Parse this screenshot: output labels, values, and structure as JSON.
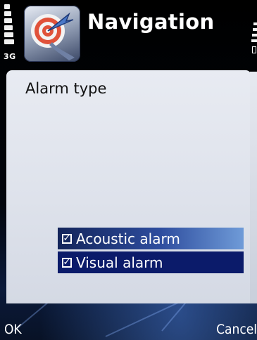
{
  "status": {
    "network_label": "3G"
  },
  "app": {
    "title": "Navigation",
    "icon": "navigation-target-icon"
  },
  "dialog": {
    "heading": "Alarm type",
    "items": [
      {
        "label": "Acoustic alarm",
        "checked": true,
        "focused": true
      },
      {
        "label": "Visual alarm",
        "checked": true,
        "focused": false
      }
    ]
  },
  "softkeys": {
    "left": "OK",
    "right": "Cancel"
  },
  "colors": {
    "highlight": "#0b1b6a",
    "dialog_bg": "#dfe3ec"
  }
}
